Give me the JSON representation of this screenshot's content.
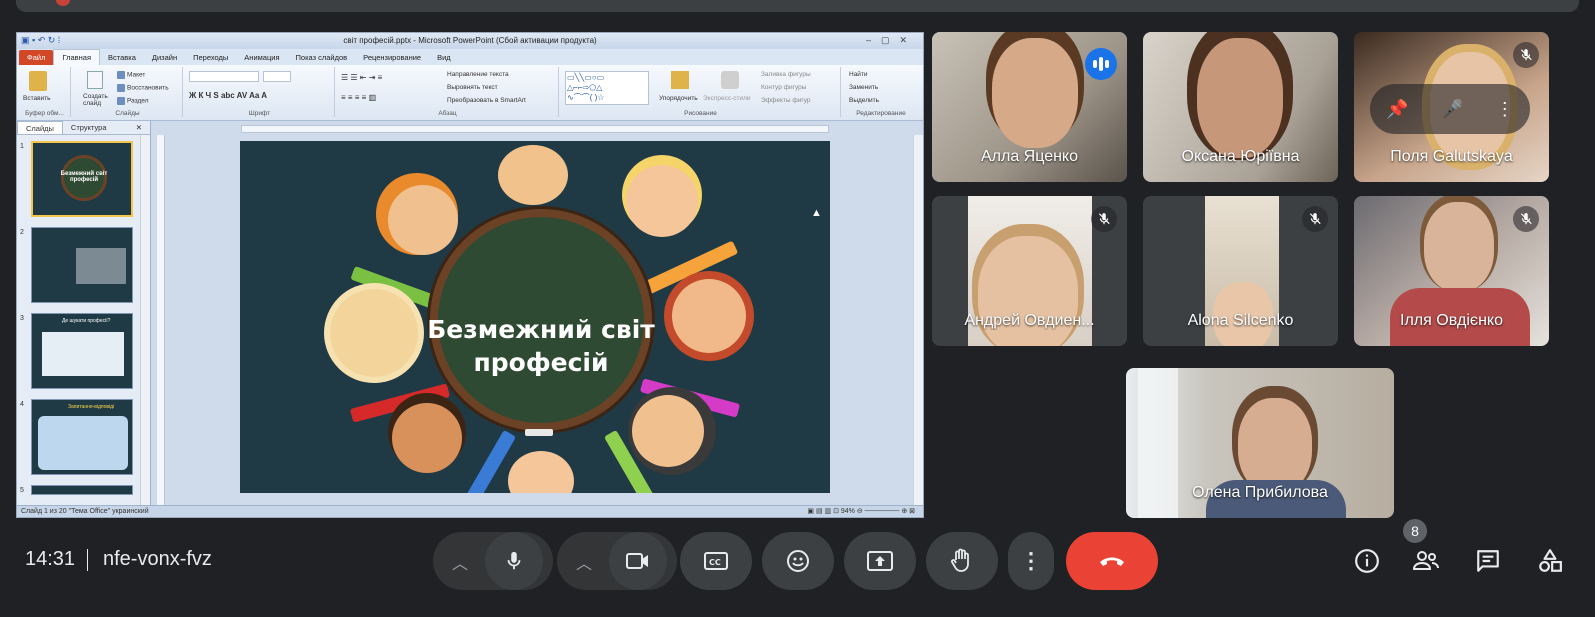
{
  "powerpoint": {
    "title": "світ професій.pptx - Microsoft PowerPoint (Сбой активации продукта)",
    "tabs": [
      "Файл",
      "Главная",
      "Вставка",
      "Дизайн",
      "Переходы",
      "Анимация",
      "Показ слайдов",
      "Рецензирование",
      "Вид"
    ],
    "ribbon": {
      "paste": "Вставить",
      "new_slide": "Создать слайд",
      "layout": "Макет",
      "restore": "Восстановить",
      "section": "Раздел",
      "text_direction": "Направление текста",
      "align_text": "Выровнять текст",
      "smartart": "Преобразовать в SmartArt",
      "arrange": "Упорядочить",
      "quick_styles": "Экспресс-стили",
      "shape_fill": "Заливка фигуры",
      "shape_outline": "Контур фигуры",
      "shape_effects": "Эффекты фигур",
      "find": "Найти",
      "replace": "Заменить",
      "select": "Выделить",
      "group_clipboard": "Буфер обм...",
      "group_slides": "Слайды",
      "group_font": "Шрифт",
      "group_paragraph": "Абзац",
      "group_drawing": "Рисование",
      "group_editing": "Редактирование"
    },
    "pane_tabs": [
      "Слайды",
      "Структура"
    ],
    "thumb_numbers": [
      "1",
      "2",
      "3",
      "4",
      "5"
    ],
    "thumb_titles": [
      "Безмежний світ професій",
      "Де шукати професії?",
      "Запитання-відповіді"
    ],
    "slide_title_line1": "Безмежний світ",
    "slide_title_line2": "професій",
    "status": "Слайд 1 из 20   \"Тема Office\"   украинский",
    "zoom": "94%"
  },
  "participants": [
    {
      "name": "Алла Яценко",
      "speaking": true,
      "muted": false
    },
    {
      "name": "Оксана Юріївна",
      "speaking": false,
      "muted": false
    },
    {
      "name": "Поля Galutskaya",
      "speaking": false,
      "muted": true
    },
    {
      "name": "Андрей Овдиен...",
      "speaking": false,
      "muted": true
    },
    {
      "name": "Alona Silcenko",
      "speaking": false,
      "muted": true
    },
    {
      "name": "Ілля Овдієнко",
      "speaking": false,
      "muted": true
    },
    {
      "name": "Олена Прибилова",
      "speaking": false,
      "muted": false
    }
  ],
  "meeting": {
    "time": "14:31",
    "code": "nfe-vonx-fvz",
    "participant_count": "8"
  },
  "icons": {
    "mic": "mic-icon",
    "camera": "camera-icon",
    "captions": "captions-icon",
    "emoji": "emoji-icon",
    "present": "present-icon",
    "hand": "raise-hand-icon",
    "more": "more-vert-icon",
    "hangup": "phone-hangup-icon",
    "info": "info-icon",
    "people": "people-icon",
    "chat": "chat-icon",
    "activities": "activities-icon"
  },
  "colors": {
    "hangup": "#ea4335",
    "accent": "#8ab4f8",
    "speaking": "#1a73e8",
    "bg": "#202124"
  }
}
